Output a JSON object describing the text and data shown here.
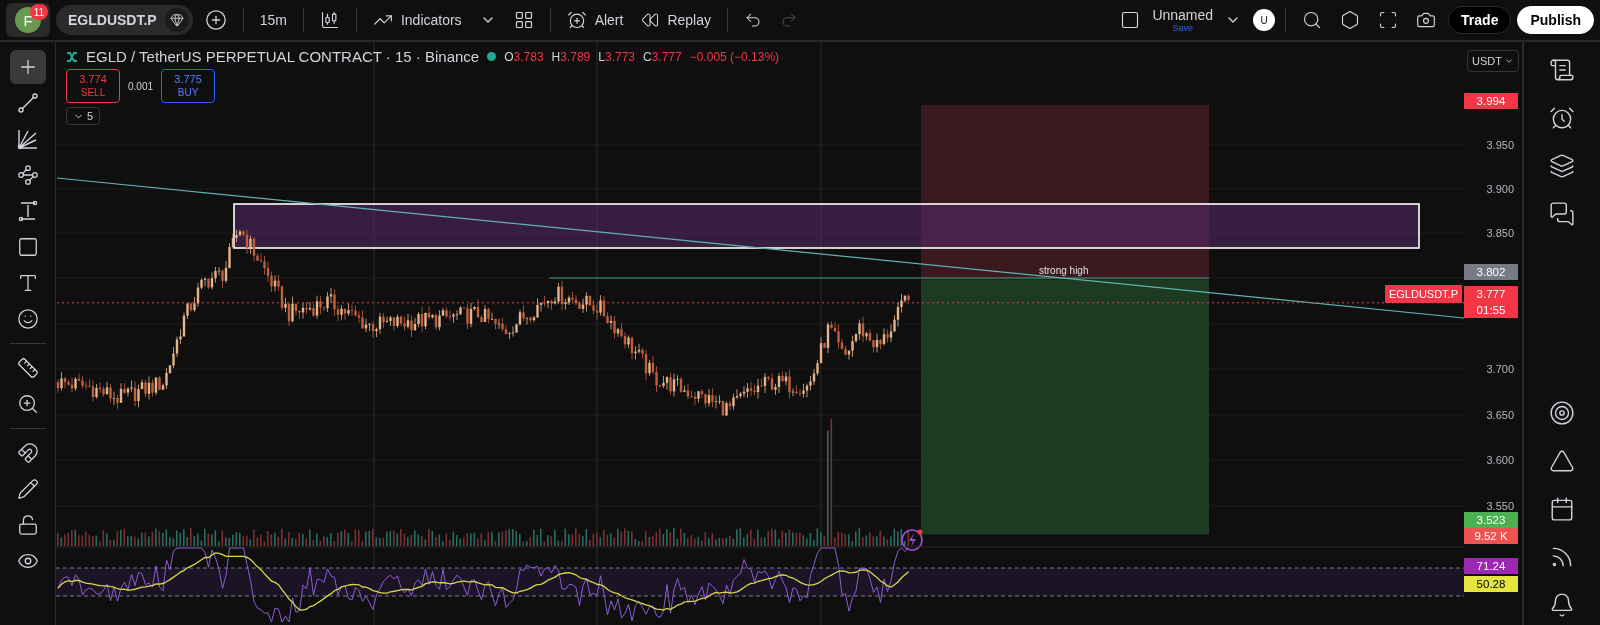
{
  "top_bar": {
    "avatar": {
      "letter": "F",
      "badge": "11"
    },
    "symbol": "EGLDUSDT.P",
    "interval": "15m",
    "indicators": "Indicators",
    "alert": "Alert",
    "replay": "Replay",
    "undo": {
      "disabled": false
    },
    "redo": {
      "disabled": true
    },
    "layout": {
      "name": "Unnamed",
      "save": "Save"
    },
    "user_avatar": "U",
    "buttons": [
      {
        "label": "Trade",
        "kind": "dark"
      },
      {
        "label": "Publish",
        "kind": "light"
      }
    ]
  },
  "left_toolbar": {
    "groups": [
      [
        {
          "kind": "crosshair",
          "selected": true
        },
        {
          "kind": "line",
          "selected": false
        },
        {
          "kind": "fib",
          "selected": false
        },
        {
          "kind": "pattern",
          "selected": false
        },
        {
          "kind": "measure",
          "selected": false
        },
        {
          "kind": "rectangle",
          "selected": false
        },
        {
          "kind": "text",
          "selected": false
        },
        {
          "kind": "emoji",
          "selected": false
        }
      ],
      [
        {
          "kind": "ruler",
          "selected": false
        },
        {
          "kind": "zoom",
          "selected": false
        }
      ],
      [
        {
          "kind": "magnet",
          "selected": false
        },
        {
          "kind": "pencil",
          "selected": false
        },
        {
          "kind": "lock",
          "selected": false
        },
        {
          "kind": "eye",
          "selected": false
        }
      ]
    ]
  },
  "legend": {
    "title": "EGLD / TetherUS PERPETUAL CONTRACT · 15 · Binance",
    "market_open": true,
    "ohlc": [
      {
        "key": "O",
        "value": "3.783"
      },
      {
        "key": "H",
        "value": "3.789"
      },
      {
        "key": "L",
        "value": "3.773"
      },
      {
        "key": "C",
        "value": "3.777"
      }
    ],
    "change": "−0.005 (−0.13%)",
    "sell": {
      "price": "3.774",
      "label": "SELL"
    },
    "spread": "0.001",
    "buy": {
      "price": "3.775",
      "label": "BUY"
    },
    "collapsed_count": "5"
  },
  "chart": {
    "line_label": "strong high",
    "symbol_tag": "EGLDUSDT.P"
  },
  "price_axis": {
    "currency": "USDT",
    "ticks": [
      "3.950",
      "3.900",
      "3.850",
      "3.700",
      "3.650",
      "3.600",
      "3.550"
    ],
    "labels": [
      {
        "text": "3.994",
        "color": "#f23645"
      },
      {
        "text": "3.802",
        "color": "#787b86"
      },
      {
        "text": "3.777",
        "color": "#f23645"
      },
      {
        "text": "01:55",
        "color": "#f23645"
      },
      {
        "text": "3.523",
        "color": "#4caf50"
      },
      {
        "text": "9.52 K",
        "color": "#ef5350"
      },
      {
        "text": "71.24",
        "color": "#9c27b0"
      },
      {
        "text": "50.28",
        "color": "#e5e540"
      }
    ]
  },
  "right_toolbar": {
    "top": [
      {
        "kind": "watchlist"
      },
      {
        "kind": "alerts"
      },
      {
        "kind": "layers"
      },
      {
        "kind": "chat"
      }
    ],
    "bottom": [
      {
        "kind": "target"
      },
      {
        "kind": "ideas"
      },
      {
        "kind": "calendar"
      },
      {
        "kind": "signal"
      },
      {
        "kind": "bell"
      }
    ]
  }
}
